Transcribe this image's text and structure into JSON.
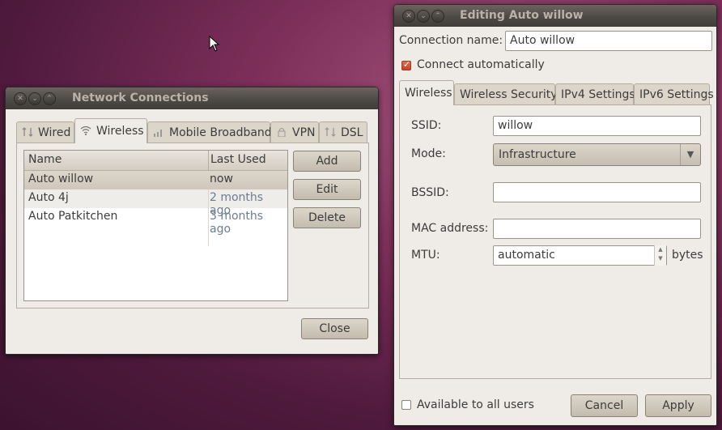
{
  "network_connections": {
    "title": "Network Connections",
    "tabs": [
      {
        "label": "Wired",
        "icon": "wired-icon"
      },
      {
        "label": "Wireless",
        "icon": "wifi-icon"
      },
      {
        "label": "Mobile Broadband",
        "icon": "signal-bars-icon"
      },
      {
        "label": "VPN",
        "icon": "lock-icon"
      },
      {
        "label": "DSL",
        "icon": "dsl-icon"
      }
    ],
    "active_tab": "Wireless",
    "columns": [
      "Name",
      "Last Used"
    ],
    "rows": [
      {
        "name": "Auto willow",
        "last_used": "now",
        "selected": true
      },
      {
        "name": "Auto 4j",
        "last_used": "2 months ago",
        "selected": false
      },
      {
        "name": "Auto Patkitchen",
        "last_used": "3 months ago",
        "selected": false
      }
    ],
    "buttons": {
      "add": "Add",
      "edit": "Edit",
      "delete": "Delete",
      "close": "Close"
    }
  },
  "editor": {
    "title": "Editing Auto willow",
    "connection_name_label": "Connection name:",
    "connection_name_value": "Auto willow",
    "connect_automatically_label": "Connect automatically",
    "connect_automatically_checked": true,
    "tabs": [
      "Wireless",
      "Wireless Security",
      "IPv4 Settings",
      "IPv6 Settings"
    ],
    "active_tab": "Wireless",
    "ssid_label": "SSID:",
    "ssid_value": "willow",
    "mode_label": "Mode:",
    "mode_value": "Infrastructure",
    "bssid_label": "BSSID:",
    "bssid_value": "",
    "mac_label": "MAC address:",
    "mac_value": "",
    "mtu_label": "MTU:",
    "mtu_value": "automatic",
    "mtu_unit": "bytes",
    "available_label": "Available to all users",
    "available_checked": false,
    "cancel": "Cancel",
    "apply": "Apply"
  },
  "colors": {
    "desktop": "#7d2f5a",
    "window_bg": "#efebe6",
    "titlebar": "#4e4a45",
    "checkbox_accent": "#d4553a"
  }
}
